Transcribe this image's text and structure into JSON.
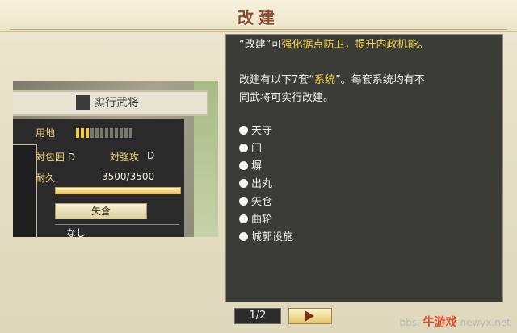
{
  "screen": {
    "title": "改建"
  },
  "preview": {
    "top_text": "实行武将",
    "land_label": "用地",
    "land_level": {
      "filled": 3,
      "total": 12
    },
    "anti_siege_label": "対包囲",
    "anti_siege_grade": "D",
    "anti_assault_label": "対強攻",
    "anti_assault_grade": "D",
    "durability_label": "耐久",
    "durability_value": "3500/3500",
    "durability_fill": 1.0,
    "button_label": "矢倉",
    "bottom_text": "なし"
  },
  "info": {
    "line1_q1": "“改建”",
    "line1_mid": "可",
    "line1_hl": "强化据点防卫，提升内政机能。",
    "line2_a": "改建有以下7套“",
    "line2_hl": "系统",
    "line2_b": "”。每套系统均有不",
    "line3": "同武将可实行改建。",
    "items": [
      "天守",
      "门",
      "塀",
      "出丸",
      "矢仓",
      "曲轮",
      "城郭设施"
    ]
  },
  "pager": {
    "label": "1/2"
  },
  "watermark": {
    "brand": "牛游戏",
    "url": "newyx.net",
    "partial": "bbs."
  },
  "colors": {
    "title": "#8a4a2a",
    "highlight": "#f0d24a",
    "panel": "#3b3b37"
  }
}
